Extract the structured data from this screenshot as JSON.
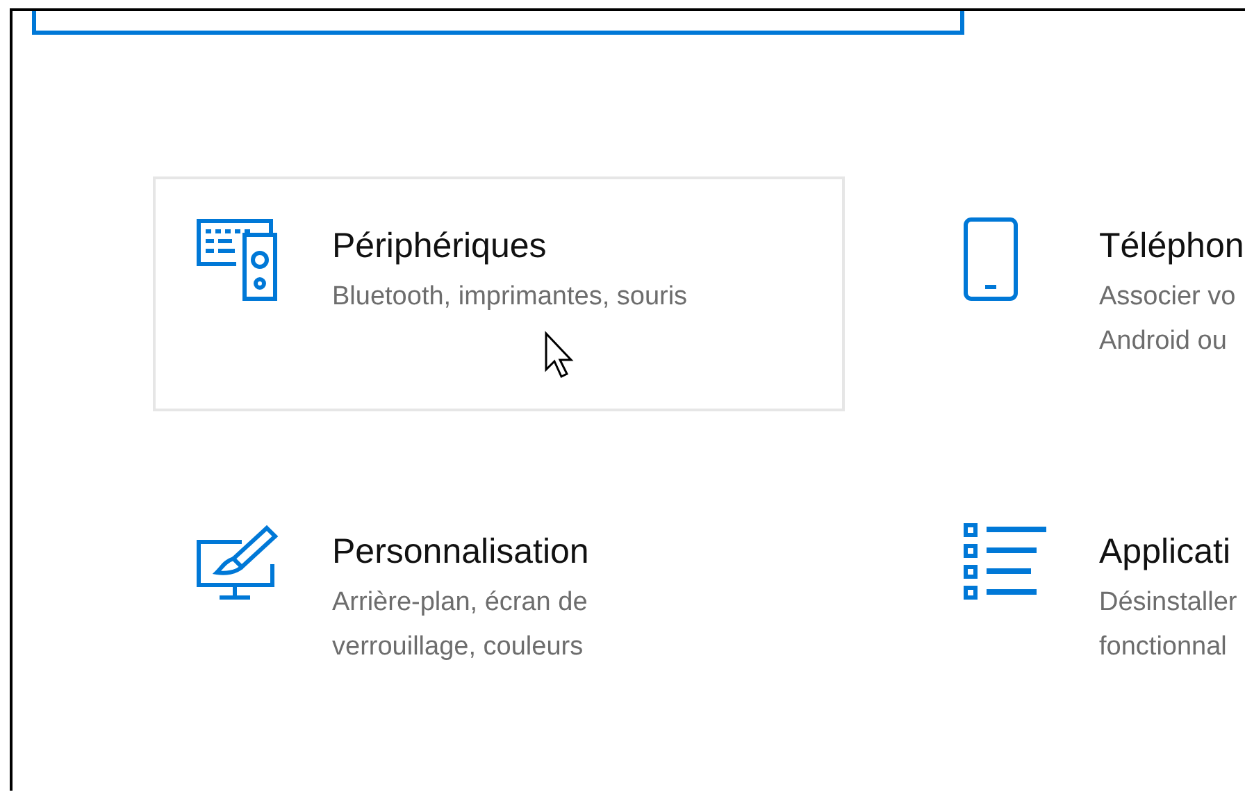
{
  "tiles": [
    {
      "kind": "devices",
      "title": "Périphériques",
      "description": [
        "Bluetooth, imprimantes, souris"
      ],
      "hovered": true
    },
    {
      "kind": "phone",
      "title": "Téléphon",
      "description": [
        "Associer vo",
        "Android ou"
      ],
      "hovered": false
    },
    {
      "kind": "personalize",
      "title": "Personnalisation",
      "description": [
        "Arrière-plan, écran de",
        "verrouillage, couleurs"
      ],
      "hovered": false
    },
    {
      "kind": "apps",
      "title": "Applicati",
      "description": [
        "Désinstaller",
        "fonctionnal"
      ],
      "hovered": false
    }
  ]
}
